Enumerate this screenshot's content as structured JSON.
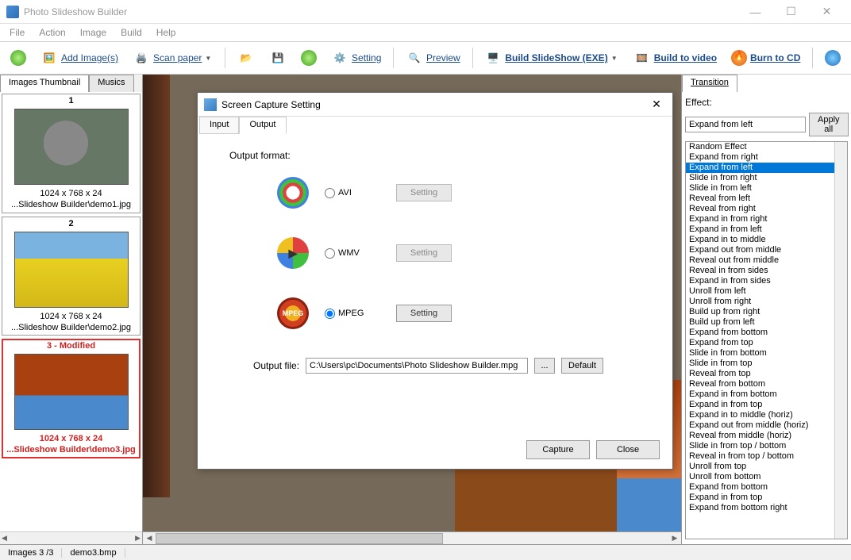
{
  "app": {
    "title": "Photo Slideshow Builder"
  },
  "menu": [
    "File",
    "Action",
    "Image",
    "Build",
    "Help"
  ],
  "toolbar": {
    "add_images": "Add Image(s)",
    "scan_paper": "Scan paper",
    "setting": "Setting",
    "preview": "Preview",
    "build_exe": "Build SlideShow (EXE)",
    "build_video": "Build to video",
    "burn_cd": "Burn to CD"
  },
  "left": {
    "tab_images": "Images Thumbnail",
    "tab_musics": "Musics",
    "items": [
      {
        "num": "1",
        "dim": "1024 x 768 x 24",
        "path": "...Slideshow Builder\\demo1.jpg"
      },
      {
        "num": "2",
        "dim": "1024 x 768 x 24",
        "path": "...Slideshow Builder\\demo2.jpg"
      },
      {
        "num": "3 - Modified",
        "dim": "1024 x 768 x 24",
        "path": "...Slideshow Builder\\demo3.jpg"
      }
    ]
  },
  "right": {
    "tab": "Transition",
    "effect_label": "Effect:",
    "current_effect": "Expand from left",
    "apply_all": "Apply all",
    "effects": [
      "Random Effect",
      "Expand from right",
      "Expand from left",
      "Slide in from right",
      "Slide in from left",
      "Reveal from left",
      "Reveal from right",
      "Expand in from right",
      "Expand in from left",
      "Expand in to middle",
      "Expand out from middle",
      "Reveal out from middle",
      "Reveal in from sides",
      "Expand in from sides",
      "Unroll from left",
      "Unroll from right",
      "Build up from right",
      "Build up from left",
      "Expand from bottom",
      "Expand from top",
      "Slide in from bottom",
      "Slide in from top",
      "Reveal from top",
      "Reveal from bottom",
      "Expand in from bottom",
      "Expand in from top",
      "Expand in to middle (horiz)",
      "Expand out from middle (horiz)",
      "Reveal from middle (horiz)",
      "Slide in from top / bottom",
      "Reveal in from top / bottom",
      "Unroll from top",
      "Unroll from bottom",
      "Expand from bottom",
      "Expand in from top",
      "Expand from bottom right"
    ],
    "selected_index": 2
  },
  "dialog": {
    "title": "Screen Capture Setting",
    "tab_input": "Input",
    "tab_output": "Output",
    "output_format_label": "Output format:",
    "formats": {
      "avi": "AVI",
      "wmv": "WMV",
      "mpeg": "MPEG"
    },
    "setting_btn": "Setting",
    "output_file_label": "Output file:",
    "output_file": "C:\\Users\\pc\\Documents\\Photo Slideshow Builder.mpg",
    "browse": "...",
    "default": "Default",
    "capture": "Capture",
    "close": "Close"
  },
  "status": {
    "images": "Images 3 /3",
    "file": "demo3.bmp"
  }
}
